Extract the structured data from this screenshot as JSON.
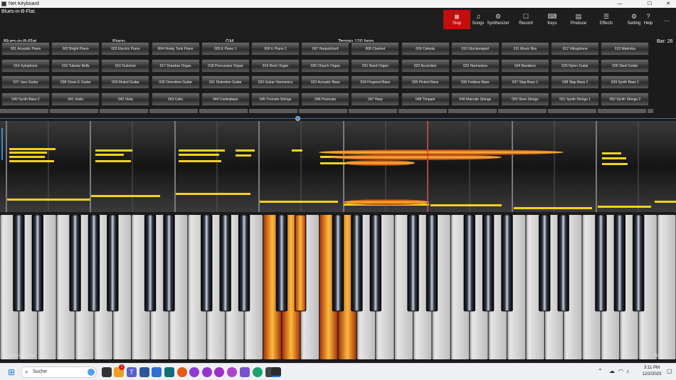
{
  "window": {
    "title": "Net Keyboard",
    "controls": [
      "—",
      "☐",
      "✕"
    ]
  },
  "song": {
    "title": "Blues-in-B-Flat.",
    "name": "Blues-in-B-Flat",
    "instrument": "Piano",
    "standard": "GM",
    "tempo": "Tempo 120 bpm",
    "bar": "Bar: 26"
  },
  "toolbar": [
    {
      "name": "stop",
      "label": "Stop",
      "icon": "◼",
      "active": true
    },
    {
      "name": "songs",
      "label": "Songs",
      "icon": "♫"
    },
    {
      "name": "synthesizer",
      "label": "Synthesizer",
      "icon": "⚙"
    },
    {
      "name": "record",
      "label": "Record",
      "icon": "☐"
    },
    {
      "name": "keys",
      "label": "Keys",
      "icon": "⌨"
    },
    {
      "name": "produce",
      "label": "Produce",
      "icon": "▤"
    },
    {
      "name": "effects",
      "label": "Effects",
      "icon": "☰"
    },
    {
      "name": "setting",
      "label": "Setting",
      "icon": "⚙"
    },
    {
      "name": "help",
      "label": "Help",
      "icon": "?"
    }
  ],
  "more_label": "⋯",
  "instruments": [
    [
      "001 Acoustic Piano",
      "002 Bright Piano",
      "003 Electric Piano",
      "004 Honky Tonk Piano",
      "005 E Piano 1",
      "006 E Piano 2",
      "007 Harpsichord",
      "008 Clavinet",
      "009 Celesta",
      "010 Glockenspiel",
      "011 Music Box",
      "012 Vibraphone",
      "013 Marimba"
    ],
    [
      "014 Xylophone",
      "015 Tubular Bells",
      "016 Dulcimer",
      "017 Drawbar Organ",
      "018 Percussive Organ",
      "019 Rock Organ",
      "020 Church Organ",
      "021 Reed Organ",
      "022 Accordion",
      "023 Harmonica",
      "024 Bandeon",
      "025 Nylon Guitar",
      "026 Steel Guitar"
    ],
    [
      "027 Jazz Guitar",
      "028 Clean E Guitar",
      "029 Muted Guitar",
      "030 Overdrive Guitar",
      "031 Distortion Guitar",
      "032 Guitar Harmonics",
      "033 Acoustic Bass",
      "034 Fingered Bass",
      "035 Picked Bass",
      "036 Fretless Bass",
      "037 Slap Bass 1",
      "038 Slap Bass 2",
      "039 Synth Bass 1"
    ],
    [
      "040 Synth Bass 2",
      "041 Violin",
      "042 Viola",
      "043 Cello",
      "044 Contrabass",
      "045 Tremolo Strings",
      "046 Pizzicato",
      "047 Harp",
      "048 Timpani",
      "049 Marcato Strings",
      "050 Slow Strings",
      "051 Synth Strings 1",
      "052 Synth Strings 2"
    ]
  ],
  "keyboard": {
    "left_label": "Blues-in-B-Flat",
    "right_label": "Bar: 26",
    "white_key_count": 36,
    "pressed_white": [
      14,
      15,
      17,
      18
    ],
    "pressed_black": [
      11
    ]
  },
  "colors": {
    "accent": "#c40d0d",
    "note": "#f2d21b",
    "playing": "#e07b10",
    "playhead": "#d41c1c"
  },
  "taskbar": {
    "search_placeholder": "Suche",
    "time": "3:11 PM",
    "date": "12/2/2023",
    "badge": "1"
  }
}
